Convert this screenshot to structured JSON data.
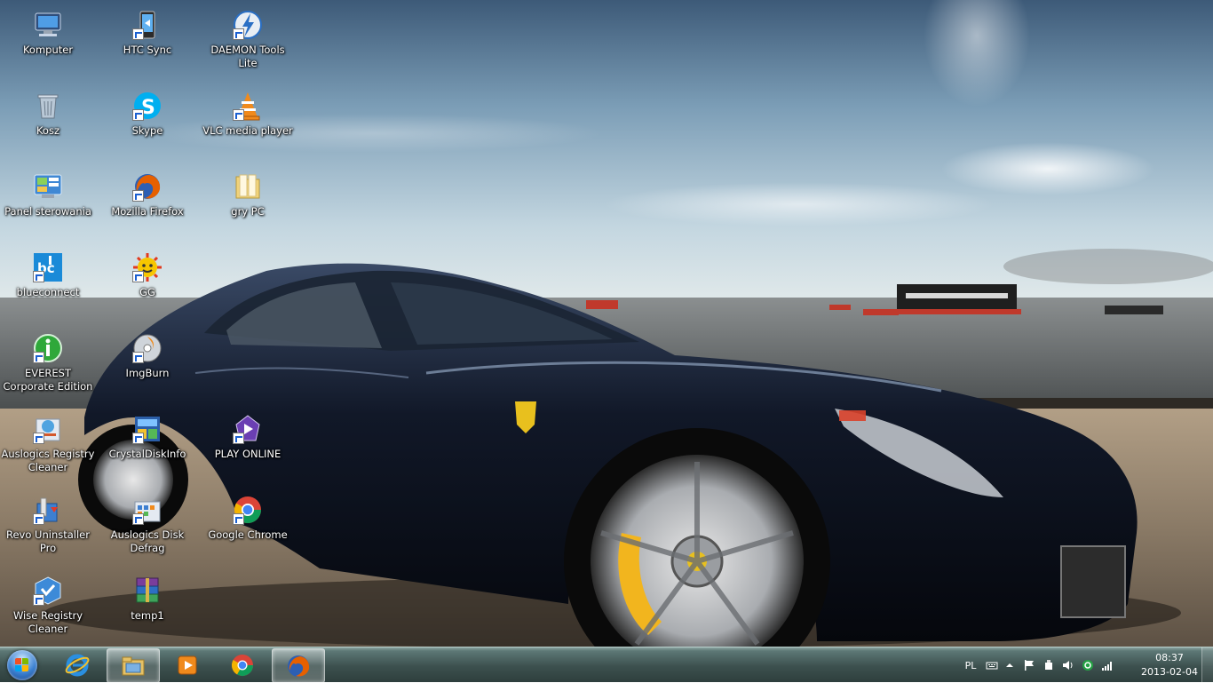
{
  "desktop": {
    "icons": [
      {
        "label": "Komputer",
        "icon": "computer-icon"
      },
      {
        "label": "Kosz",
        "icon": "recycle-bin-icon"
      },
      {
        "label": "Panel sterowania",
        "icon": "control-panel-icon"
      },
      {
        "label": "blueconnect",
        "icon": "blueconnect-icon"
      },
      {
        "label": "EVEREST Corporate Edition",
        "icon": "everest-icon"
      },
      {
        "label": "Auslogics Registry Cleaner",
        "icon": "auslogics-registry-icon"
      },
      {
        "label": "Revo Uninstaller Pro",
        "icon": "revo-uninstaller-icon"
      },
      {
        "label": "Wise Registry Cleaner",
        "icon": "wise-registry-icon"
      },
      {
        "label": "HTC Sync",
        "icon": "htc-sync-icon"
      },
      {
        "label": "Skype",
        "icon": "skype-icon"
      },
      {
        "label": "Mozilla Firefox",
        "icon": "firefox-icon"
      },
      {
        "label": "GG",
        "icon": "gg-icon"
      },
      {
        "label": "ImgBurn",
        "icon": "imgburn-icon"
      },
      {
        "label": "CrystalDiskInfo",
        "icon": "crystaldiskinfo-icon"
      },
      {
        "label": "Auslogics Disk Defrag",
        "icon": "auslogics-defrag-icon"
      },
      {
        "label": "temp1",
        "icon": "winrar-archive-icon"
      },
      {
        "label": "DAEMON Tools Lite",
        "icon": "daemon-tools-icon"
      },
      {
        "label": "VLC media player",
        "icon": "vlc-icon"
      },
      {
        "label": "gry PC",
        "icon": "folder-icon"
      },
      {
        "label": "PLAY ONLINE",
        "icon": "play-online-icon"
      },
      {
        "label": "Google Chrome",
        "icon": "chrome-icon"
      }
    ]
  },
  "taskbar": {
    "items": [
      {
        "name": "internet-explorer",
        "icon": "internet-explorer-icon",
        "active": false
      },
      {
        "name": "windows-explorer",
        "icon": "folder-library-icon",
        "active": true
      },
      {
        "name": "media-player",
        "icon": "media-player-icon",
        "active": false
      },
      {
        "name": "google-chrome",
        "icon": "chrome-icon",
        "active": false
      },
      {
        "name": "mozilla-firefox",
        "icon": "firefox-icon",
        "active": true
      }
    ],
    "tray": {
      "language": "PL",
      "time": "08:37",
      "date": "2013-02-04",
      "icons": [
        "keyboard-icon",
        "show-hidden-icons-arrow",
        "action-center-flag-icon",
        "usb-device-icon",
        "volume-icon",
        "network-status-icon",
        "wifi-signal-icon"
      ]
    }
  },
  "colors": {
    "taskbar_top": "#8aa4a0",
    "taskbar_bottom": "#2e3f3d",
    "label_text": "#ffffff"
  }
}
